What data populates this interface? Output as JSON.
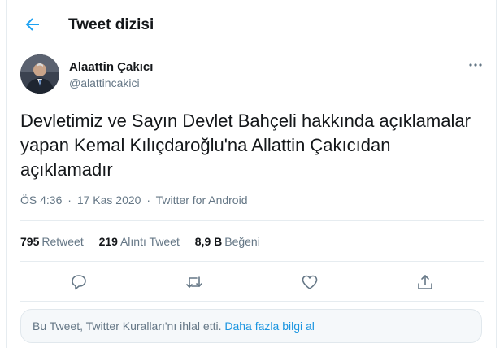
{
  "header": {
    "title": "Tweet dizisi"
  },
  "author": {
    "name": "Alaattin Çakıcı",
    "handle": "@alattincakici"
  },
  "tweet": {
    "lines": [
      "Devletimiz ve Sayın Devlet Bahçeli hakkında  açıklamalar",
      "yapan Kemal Kılıçdaroğlu'na Allattin Çakıcıdan",
      "açıklamadır"
    ],
    "time": "ÖS 4:36",
    "date": "17 Kas 2020",
    "separator": "·",
    "source": "Twitter for Android"
  },
  "stats": [
    {
      "count": "795",
      "label": "Retweet"
    },
    {
      "count": "219",
      "label": "Alıntı Tweet"
    },
    {
      "count": "8,9 B",
      "label": "Beğeni"
    }
  ],
  "notice": {
    "text": "Bu Tweet, Twitter Kuralları'nı ihlal etti.",
    "link": "Daha fazla bilgi al"
  },
  "icons": {
    "back": "back-arrow-icon",
    "more": "more-options-icon",
    "reply": "reply-icon",
    "retweet": "retweet-icon",
    "like": "like-icon",
    "share": "share-icon"
  },
  "colors": {
    "accent": "#1da1f2",
    "secondary_text": "#657786",
    "link": "#1b95e0"
  }
}
